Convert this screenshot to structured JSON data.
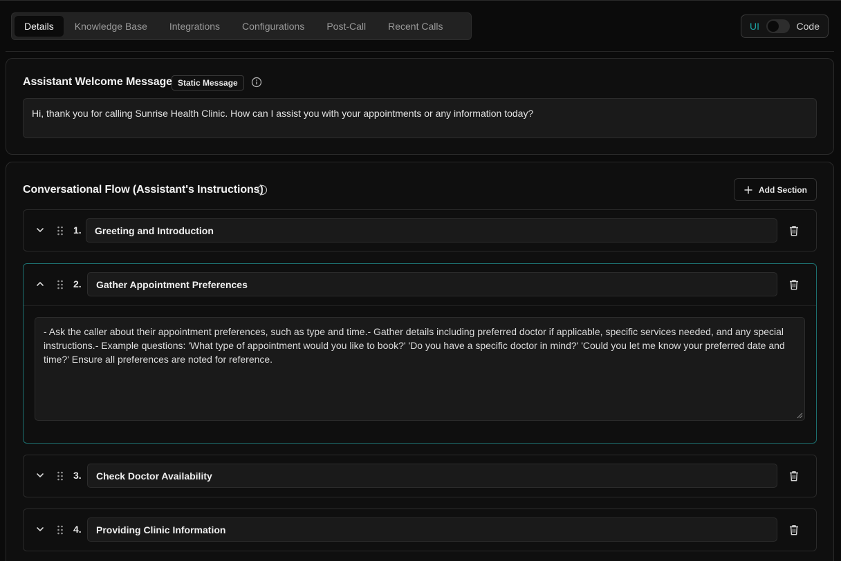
{
  "tabs": [
    {
      "label": "Details",
      "active": true
    },
    {
      "label": "Knowledge Base",
      "active": false
    },
    {
      "label": "Integrations",
      "active": false
    },
    {
      "label": "Configurations",
      "active": false
    },
    {
      "label": "Post-Call",
      "active": false
    },
    {
      "label": "Recent Calls",
      "active": false
    }
  ],
  "mode_toggle": {
    "left_label": "UI",
    "right_label": "Code",
    "active": "UI"
  },
  "welcome": {
    "title": "Assistant Welcome Message",
    "badge": "Static Message",
    "message": "Hi, thank you for calling Sunrise Health Clinic. How can I assist you with your appointments or any information today?"
  },
  "flow": {
    "title": "Conversational Flow (Assistant's Instructions)",
    "add_button_label": "Add Section",
    "sections": [
      {
        "number": "1.",
        "title": "Greeting and Introduction",
        "expanded": false
      },
      {
        "number": "2.",
        "title": "Gather Appointment Preferences",
        "expanded": true,
        "instructions": "- Ask the caller about their appointment preferences, such as type and time.- Gather details including preferred doctor if applicable, specific services needed, and any special instructions.- Example questions: 'What type of appointment would you like to book?' 'Do you have a specific doctor in mind?' 'Could you let me know your preferred date and time?' Ensure all preferences are noted for reference."
      },
      {
        "number": "3.",
        "title": "Check Doctor Availability",
        "expanded": false
      },
      {
        "number": "4.",
        "title": "Providing Clinic Information",
        "expanded": false
      }
    ]
  },
  "colors": {
    "accent": "#1ba3a3",
    "background": "#0b0b0b",
    "card": "#0f0f0f",
    "input": "#1a1a1a"
  }
}
